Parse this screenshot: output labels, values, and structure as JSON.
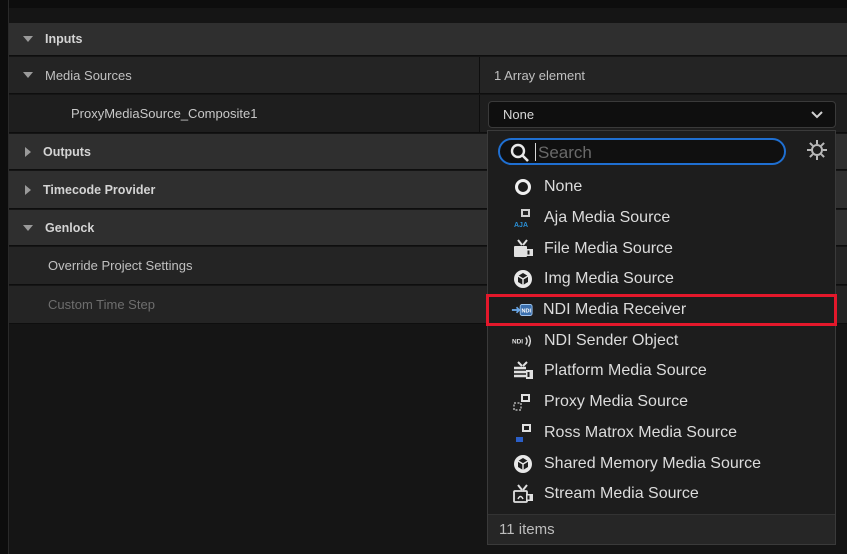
{
  "categories": {
    "inputs": "Inputs",
    "outputs": "Outputs",
    "timecode": "Timecode Provider",
    "genlock": "Genlock"
  },
  "props": {
    "media_sources": {
      "label": "Media Sources",
      "value": "1 Array element"
    },
    "proxy_composite": {
      "label": "ProxyMediaSource_Composite1"
    },
    "override": {
      "label": "Override Project Settings"
    },
    "custom_time_step": {
      "label": "Custom Time Step"
    }
  },
  "combo": {
    "value": "None"
  },
  "dropdown": {
    "search_placeholder": "Search",
    "items": [
      {
        "label": "None",
        "icon": "circle-icon"
      },
      {
        "label": "Aja Media Source",
        "icon": "aja-icon"
      },
      {
        "label": "File Media Source",
        "icon": "tv-icon"
      },
      {
        "label": "Img Media Source",
        "icon": "cube-icon"
      },
      {
        "label": "NDI Media Receiver",
        "icon": "ndi-receiver-icon"
      },
      {
        "label": "NDI Sender Object",
        "icon": "ndi-sender-icon"
      },
      {
        "label": "Platform Media Source",
        "icon": "platform-icon"
      },
      {
        "label": "Proxy Media Source",
        "icon": "proxy-icon"
      },
      {
        "label": "Ross Matrox Media Source",
        "icon": "ross-icon"
      },
      {
        "label": "Shared Memory Media Source",
        "icon": "cube-icon"
      },
      {
        "label": "Stream Media Source",
        "icon": "stream-icon"
      }
    ],
    "count": "11 items"
  },
  "colors": {
    "highlight": "#e3182b",
    "focus": "#1f6fd1"
  }
}
